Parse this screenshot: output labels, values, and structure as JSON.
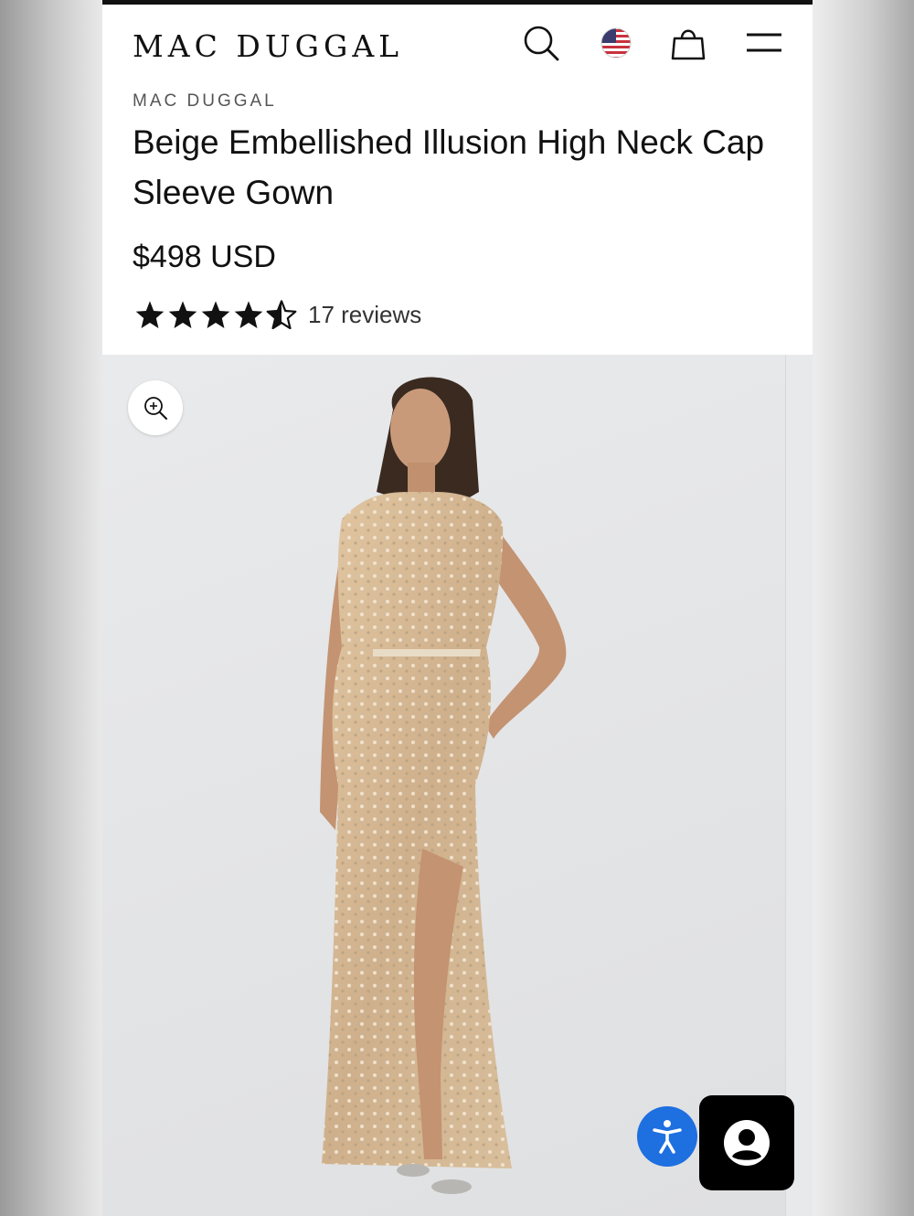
{
  "header": {
    "logo_text": "MAC DUGGAL",
    "icons": [
      "search-icon",
      "us-flag-icon",
      "shopping-bag-icon",
      "menu-icon"
    ]
  },
  "product": {
    "brand": "MAC DUGGAL",
    "title": "Beige Embellished Illusion High Neck Cap Sleeve Gown",
    "price": "$498 USD",
    "rating_value": 4.5,
    "rating_max": 5,
    "reviews_label": "17 reviews"
  },
  "gallery": {
    "image_alt": "product-photo-gown",
    "zoom_icon": "zoom-in-icon"
  },
  "floating": {
    "accessibility_icon": "accessibility-icon",
    "chat_icon": "user-avatar-icon"
  },
  "colors": {
    "accessibility_blue": "#1e6fe0",
    "dress_gold": "#d7b894",
    "text_dark": "#111111"
  }
}
